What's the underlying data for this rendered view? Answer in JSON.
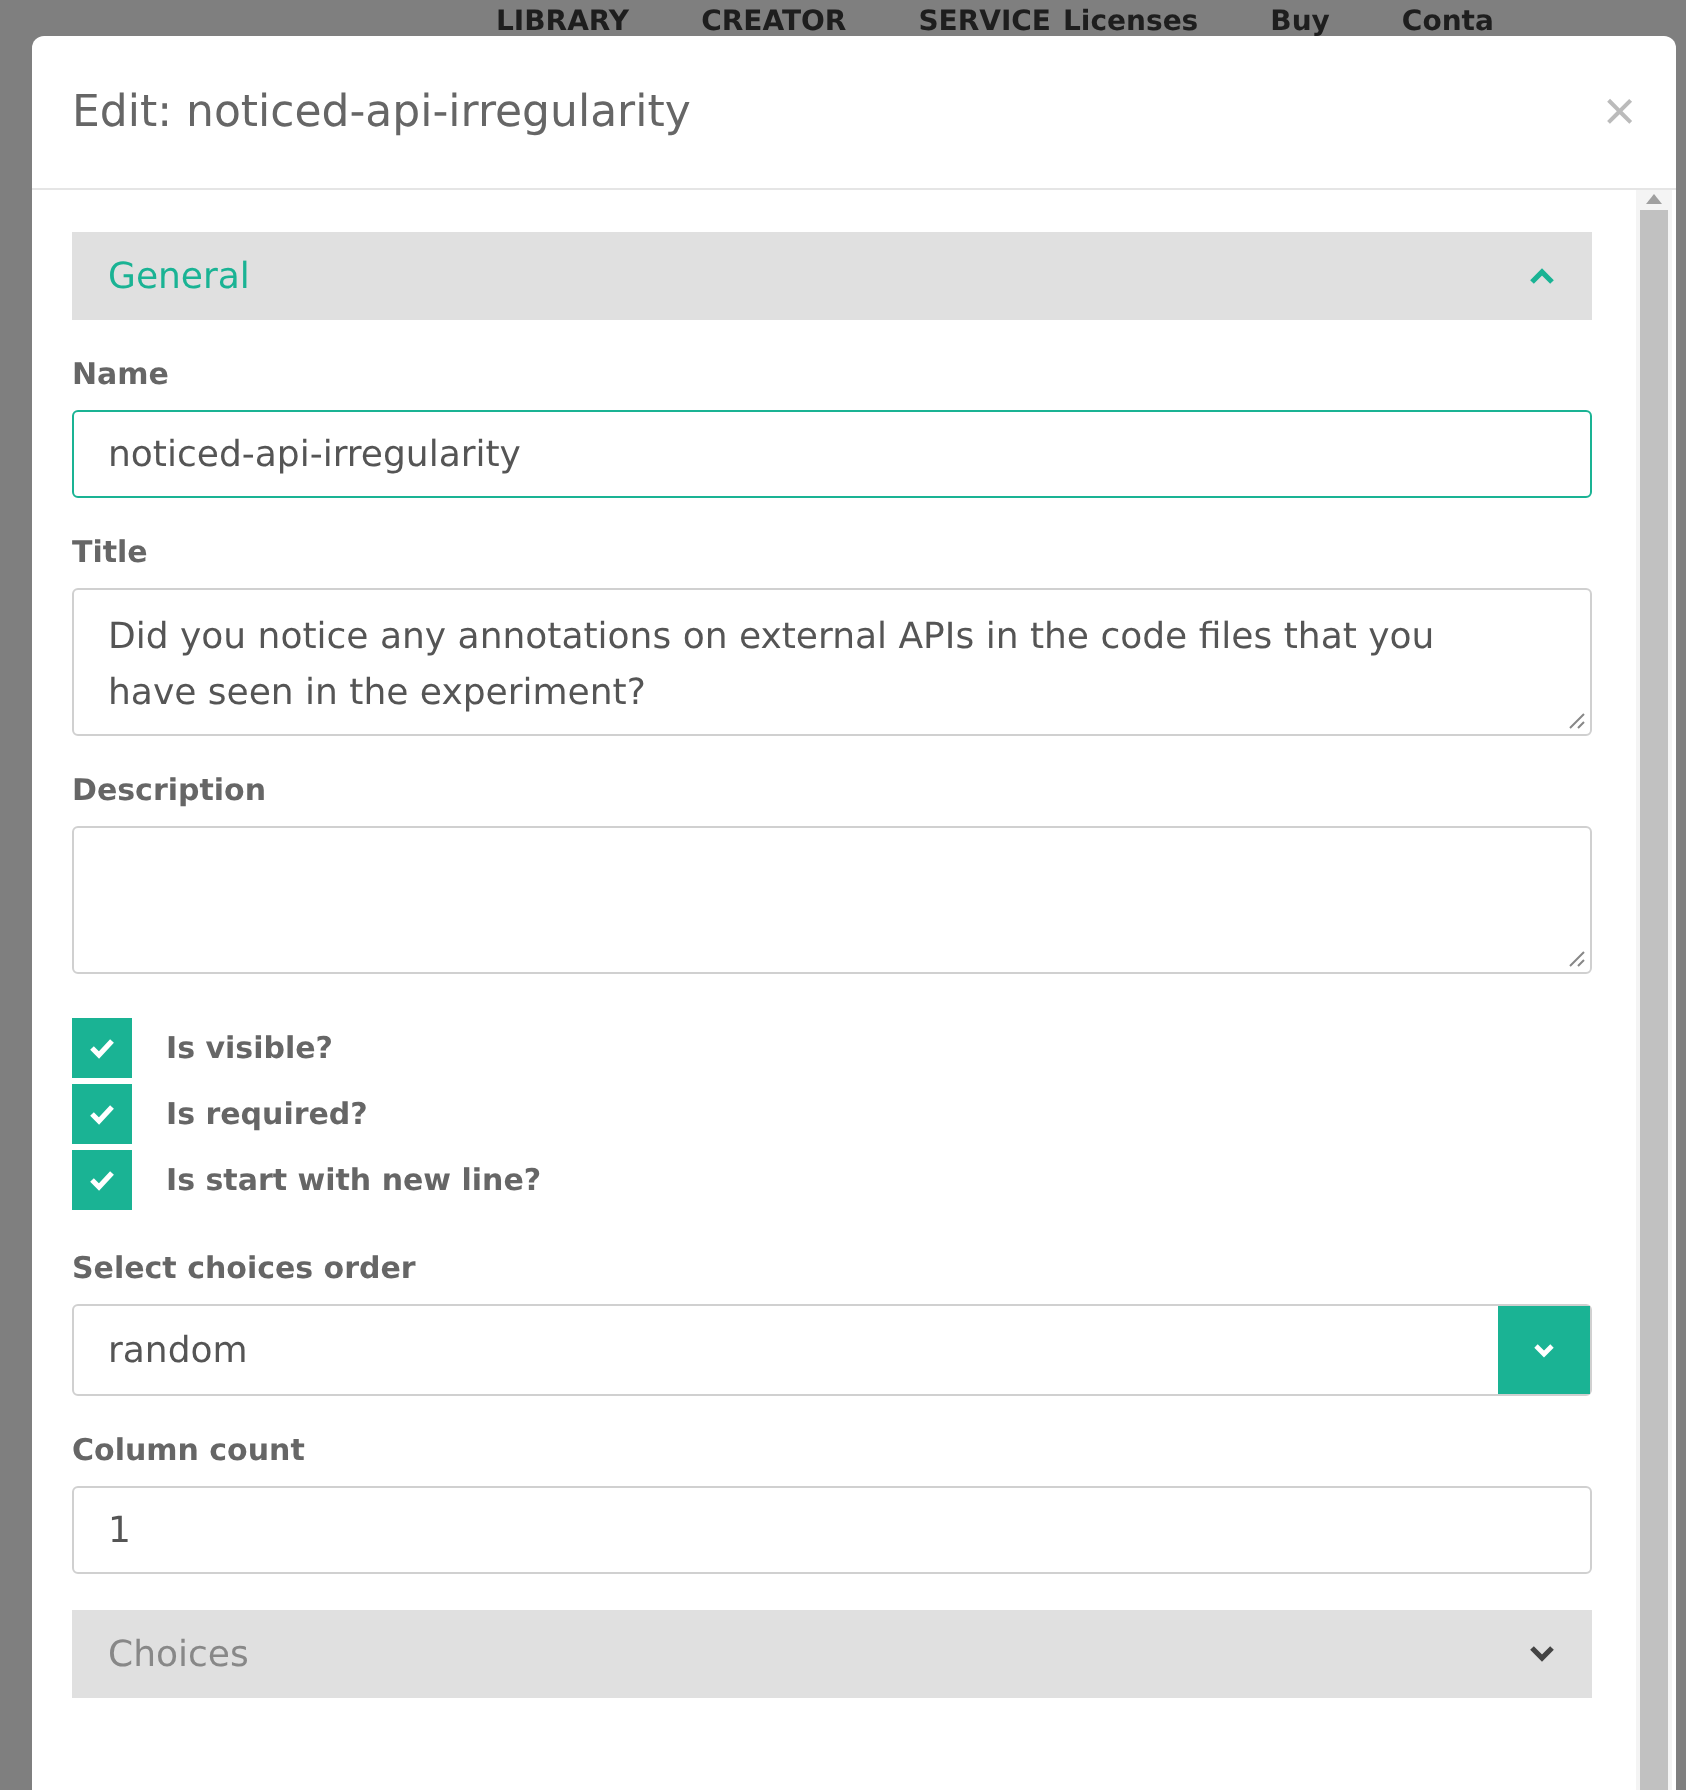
{
  "background_nav": [
    "LIBRARY",
    "CREATOR",
    "SERVICE",
    "Licenses",
    "Buy",
    "Conta"
  ],
  "dialog": {
    "title": "Edit: noticed-api-irregularity",
    "close": "×"
  },
  "items": [
    {
      "kind": "panel",
      "title": "General",
      "expanded": true
    },
    {
      "kind": "text",
      "label": "Name",
      "value": "noticed-api-irregularity",
      "focused": true
    },
    {
      "kind": "textarea",
      "label": "Title",
      "value": "Did you notice any annotations on external APIs in the code files that you have seen in the experiment?"
    },
    {
      "kind": "textarea",
      "label": "Description"
    },
    {
      "kind": "checkbox",
      "label": "Is visible?",
      "checked": true
    },
    {
      "kind": "checkbox",
      "label": "Is required?",
      "checked": true
    },
    {
      "kind": "checkbox",
      "label": "Is start with new line?",
      "checked": true
    },
    {
      "kind": "select",
      "label": "Select choices order",
      "value": "random"
    },
    {
      "kind": "text",
      "label": "Column count",
      "value": "1",
      "focused": false
    },
    {
      "kind": "panel",
      "title": "Choices",
      "expanded": false
    }
  ]
}
